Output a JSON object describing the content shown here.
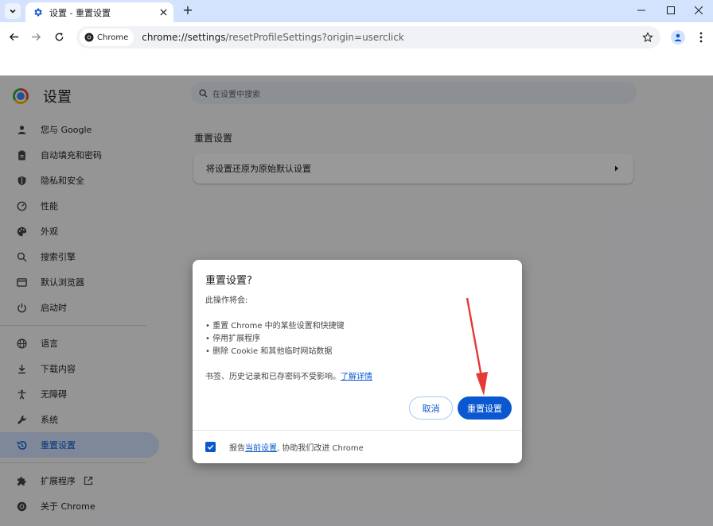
{
  "window": {
    "tab_title": "设置 - 重置设置",
    "new_tab_symbol": "+"
  },
  "toolbar": {
    "security_chip": "Chrome",
    "url_host": "chrome://settings",
    "url_path": "/resetProfileSettings?origin=userclick"
  },
  "settings": {
    "title": "设置",
    "search_placeholder": "在设置中搜索",
    "nav": [
      {
        "label": "您与 Google",
        "icon": "person-icon"
      },
      {
        "label": "自动填充和密码",
        "icon": "clipboard-icon"
      },
      {
        "label": "隐私和安全",
        "icon": "shield-icon"
      },
      {
        "label": "性能",
        "icon": "speedometer-icon"
      },
      {
        "label": "外观",
        "icon": "palette-icon"
      },
      {
        "label": "搜索引擎",
        "icon": "search-icon"
      },
      {
        "label": "默认浏览器",
        "icon": "browser-icon"
      },
      {
        "label": "启动时",
        "icon": "power-icon"
      },
      {
        "label": "语言",
        "icon": "globe-icon"
      },
      {
        "label": "下载内容",
        "icon": "download-icon"
      },
      {
        "label": "无障碍",
        "icon": "accessibility-icon"
      },
      {
        "label": "系统",
        "icon": "wrench-icon"
      },
      {
        "label": "重置设置",
        "icon": "history-icon",
        "active": true
      },
      {
        "label": "扩展程序",
        "icon": "puzzle-icon"
      },
      {
        "label": "关于 Chrome",
        "icon": "chrome-icon"
      }
    ],
    "section_title": "重置设置",
    "card_label": "将设置还原为原始默认设置"
  },
  "dialog": {
    "title": "重置设置?",
    "intro": "此操作将会:",
    "bullets": [
      "• 重置 Chrome 中的某些设置和快捷键",
      "• 停用扩展程序",
      "• 删除 Cookie 和其他临时网站数据"
    ],
    "note": "书签、历史记录和已存密码不受影响。",
    "learn_more": "了解详情",
    "cancel_label": "取消",
    "reset_label": "重置设置",
    "report_prefix": "报告",
    "report_link": "当前设置",
    "report_suffix": ", 协助我们改进 Chrome",
    "report_checked": true
  },
  "colors": {
    "accent": "#0b57d0",
    "tabstrip": "#d3e3fd",
    "annotation_arrow": "#e53935"
  }
}
